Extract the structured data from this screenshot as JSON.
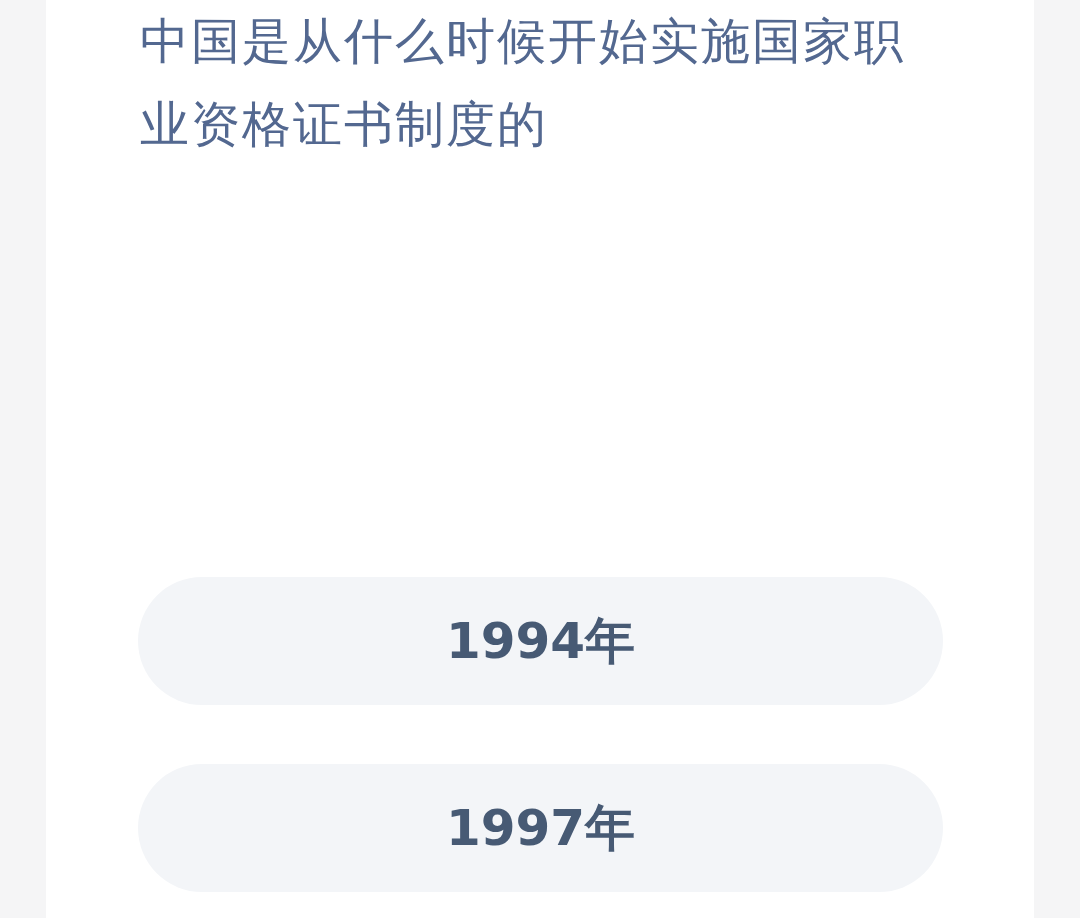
{
  "question": {
    "text": "中国是从什么时候开始实施国家职业资格证书制度的"
  },
  "options": [
    {
      "label": "1994年"
    },
    {
      "label": "1997年"
    }
  ]
}
